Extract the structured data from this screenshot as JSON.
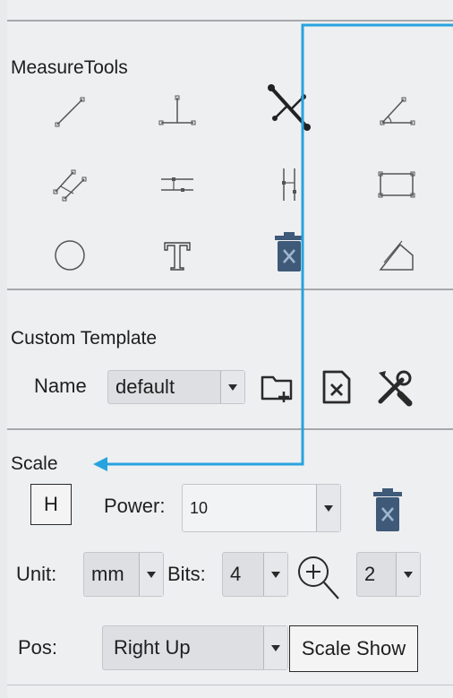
{
  "measure_tools": {
    "title": "MeasureTools",
    "tools": [
      {
        "icon": "line-icon"
      },
      {
        "icon": "perpendicular-icon"
      },
      {
        "icon": "distance-icon"
      },
      {
        "icon": "angle-icon"
      },
      {
        "icon": "parallel-lines-icon"
      },
      {
        "icon": "horizontal-lines-icon"
      },
      {
        "icon": "vertical-lines-icon"
      },
      {
        "icon": "rectangle-icon"
      },
      {
        "icon": "circle-icon"
      },
      {
        "icon": "text-icon"
      },
      {
        "icon": "trash-icon"
      },
      {
        "icon": "polygon-icon"
      }
    ]
  },
  "custom_template": {
    "title": "Custom Template",
    "name_label": "Name",
    "name_value": "default"
  },
  "scale": {
    "title": "Scale",
    "h_label": "H",
    "power_label": "Power:",
    "power_value": "10",
    "unit_label": "Unit:",
    "unit_value": "mm",
    "bits_label": "Bits:",
    "bits_value": "4",
    "zoom_value": "2",
    "pos_label": "Pos:",
    "pos_value": "Right Up",
    "scale_show_label": "Scale Show"
  },
  "colors": {
    "accent_arrow": "#27a3df",
    "trash": "#3f5a78"
  }
}
